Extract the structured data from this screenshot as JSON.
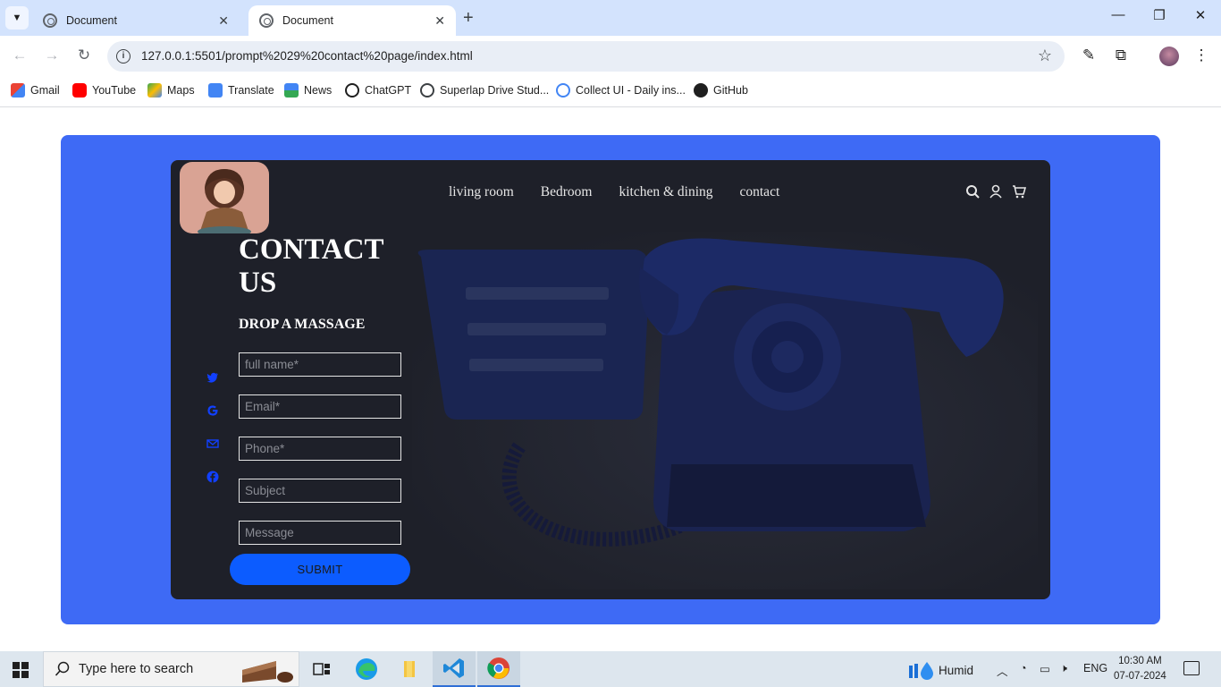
{
  "browser": {
    "tabs": [
      {
        "title": "Document",
        "active": false
      },
      {
        "title": "Document",
        "active": true
      }
    ],
    "url": "127.0.0.1:5501/prompt%2029%20contact%20page/index.html",
    "bookmarks": [
      {
        "label": "Gmail",
        "icon": "gmail-icon",
        "color": "#ea4335"
      },
      {
        "label": "YouTube",
        "icon": "youtube-icon",
        "color": "#ff0000"
      },
      {
        "label": "Maps",
        "icon": "maps-icon",
        "color": "#34a853"
      },
      {
        "label": "Translate",
        "icon": "translate-icon",
        "color": "#4285f4"
      },
      {
        "label": "News",
        "icon": "news-icon",
        "color": "#4285f4"
      },
      {
        "label": "ChatGPT",
        "icon": "chatgpt-icon",
        "color": "#1f1f1f"
      },
      {
        "label": "Superlap Drive Stud...",
        "icon": "superlap-icon",
        "color": "#3c4043"
      },
      {
        "label": "Collect UI - Daily ins...",
        "icon": "collectui-icon",
        "color": "#4285f4"
      },
      {
        "label": "GitHub",
        "icon": "github-icon",
        "color": "#1f1f1f"
      }
    ]
  },
  "page": {
    "colors": {
      "frame": "#3e6af5",
      "card": "#1e2029",
      "accent": "#0c5cff",
      "social": "#1140ff"
    },
    "nav": {
      "links": [
        "living room",
        "Bedroom",
        "kitchen & dining",
        "contact"
      ],
      "icons": [
        "search-icon",
        "user-icon",
        "cart-icon"
      ]
    },
    "title_line1": "CONTACT",
    "title_line2": "US",
    "subtitle": "DROP A MASSAGE",
    "socials": [
      "twitter-icon",
      "google-icon",
      "mail-icon",
      "facebook-icon"
    ],
    "form": {
      "full_name_placeholder": "full name*",
      "email_placeholder": "Email*",
      "phone_placeholder": "Phone*",
      "subject_placeholder": "Subject",
      "message_placeholder": "Message",
      "submit_label": "SUBMIT"
    }
  },
  "taskbar": {
    "search_placeholder": "Type here to search",
    "weather": "Humid",
    "language": "ENG",
    "time": "10:30 AM",
    "date": "07-07-2024"
  }
}
